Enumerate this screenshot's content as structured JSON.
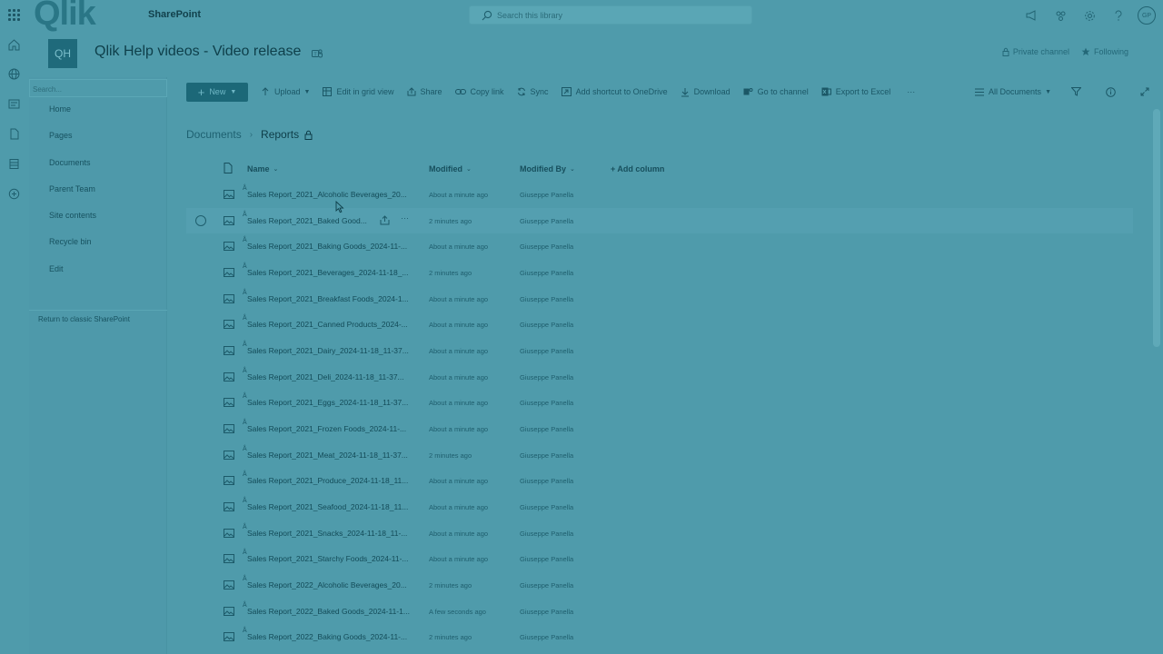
{
  "suitebar": {
    "logo": "Qlik",
    "app_name": "SharePoint",
    "search_placeholder": "Search this library",
    "avatar_initials": "GP"
  },
  "site": {
    "logo_initials": "QH",
    "title": "Qlik Help videos - Video release",
    "private_channel": "Private channel",
    "following": "Following"
  },
  "leftnav": {
    "search_placeholder": "Search...",
    "items": [
      "Home",
      "Pages",
      "Documents",
      "Parent Team",
      "Site contents",
      "Recycle bin",
      "Edit"
    ],
    "classic_link": "Return to classic SharePoint"
  },
  "commandbar": {
    "new": "New",
    "upload": "Upload",
    "edit_grid": "Edit in grid view",
    "share": "Share",
    "copy_link": "Copy link",
    "sync": "Sync",
    "add_shortcut": "Add shortcut to OneDrive",
    "download": "Download",
    "go_to_channel": "Go to channel",
    "export_excel": "Export to Excel",
    "more": "···",
    "view": "All Documents"
  },
  "breadcrumb": {
    "root": "Documents",
    "current": "Reports"
  },
  "columns": {
    "name": "Name",
    "modified": "Modified",
    "modified_by": "Modified By",
    "add_column": "+ Add column"
  },
  "files": [
    {
      "name": "Sales Report_2021_Alcoholic Beverages_20...",
      "modified": "About a minute ago",
      "by": "Giuseppe Panella"
    },
    {
      "name": "Sales Report_2021_Baked Good...",
      "modified": "2 minutes ago",
      "by": "Giuseppe Panella"
    },
    {
      "name": "Sales Report_2021_Baking Goods_2024-11-...",
      "modified": "About a minute ago",
      "by": "Giuseppe Panella"
    },
    {
      "name": "Sales Report_2021_Beverages_2024-11-18_...",
      "modified": "2 minutes ago",
      "by": "Giuseppe Panella"
    },
    {
      "name": "Sales Report_2021_Breakfast Foods_2024-1...",
      "modified": "About a minute ago",
      "by": "Giuseppe Panella"
    },
    {
      "name": "Sales Report_2021_Canned Products_2024-...",
      "modified": "About a minute ago",
      "by": "Giuseppe Panella"
    },
    {
      "name": "Sales Report_2021_Dairy_2024-11-18_11-37...",
      "modified": "About a minute ago",
      "by": "Giuseppe Panella"
    },
    {
      "name": "Sales Report_2021_Deli_2024-11-18_11-37...",
      "modified": "About a minute ago",
      "by": "Giuseppe Panella"
    },
    {
      "name": "Sales Report_2021_Eggs_2024-11-18_11-37...",
      "modified": "About a minute ago",
      "by": "Giuseppe Panella"
    },
    {
      "name": "Sales Report_2021_Frozen Foods_2024-11-...",
      "modified": "About a minute ago",
      "by": "Giuseppe Panella"
    },
    {
      "name": "Sales Report_2021_Meat_2024-11-18_11-37...",
      "modified": "2 minutes ago",
      "by": "Giuseppe Panella"
    },
    {
      "name": "Sales Report_2021_Produce_2024-11-18_11...",
      "modified": "About a minute ago",
      "by": "Giuseppe Panella"
    },
    {
      "name": "Sales Report_2021_Seafood_2024-11-18_11...",
      "modified": "About a minute ago",
      "by": "Giuseppe Panella"
    },
    {
      "name": "Sales Report_2021_Snacks_2024-11-18_11-...",
      "modified": "About a minute ago",
      "by": "Giuseppe Panella"
    },
    {
      "name": "Sales Report_2021_Starchy Foods_2024-11-...",
      "modified": "About a minute ago",
      "by": "Giuseppe Panella"
    },
    {
      "name": "Sales Report_2022_Alcoholic Beverages_20...",
      "modified": "2 minutes ago",
      "by": "Giuseppe Panella"
    },
    {
      "name": "Sales Report_2022_Baked Goods_2024-11-1...",
      "modified": "A few seconds ago",
      "by": "Giuseppe Panella"
    },
    {
      "name": "Sales Report_2022_Baking Goods_2024-11-...",
      "modified": "2 minutes ago",
      "by": "Giuseppe Panella"
    }
  ],
  "hover_row_index": 1
}
